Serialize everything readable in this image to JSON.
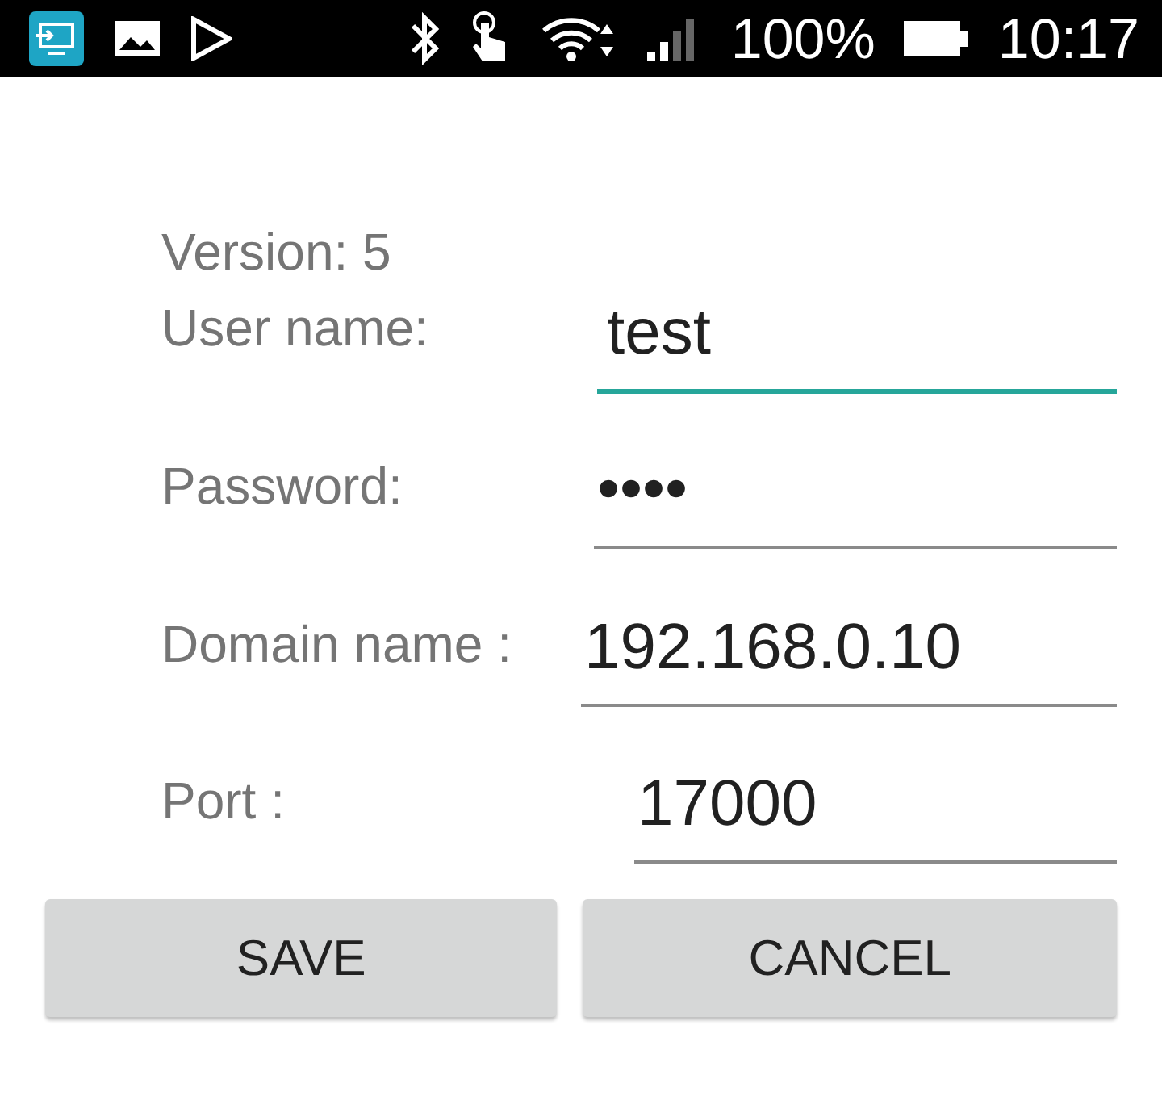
{
  "status_bar": {
    "battery": "100%",
    "time": "10:17"
  },
  "version": "Version: 5",
  "fields": [
    {
      "label": "User name:",
      "value": "test",
      "focused": true
    },
    {
      "label": "Password:",
      "value": "••••",
      "focused": false
    },
    {
      "label": "Domain name :",
      "value": "192.168.0.10",
      "focused": false
    },
    {
      "label": "Port :",
      "value": "17000",
      "focused": false
    }
  ],
  "buttons": [
    "SAVE",
    "CANCEL"
  ]
}
